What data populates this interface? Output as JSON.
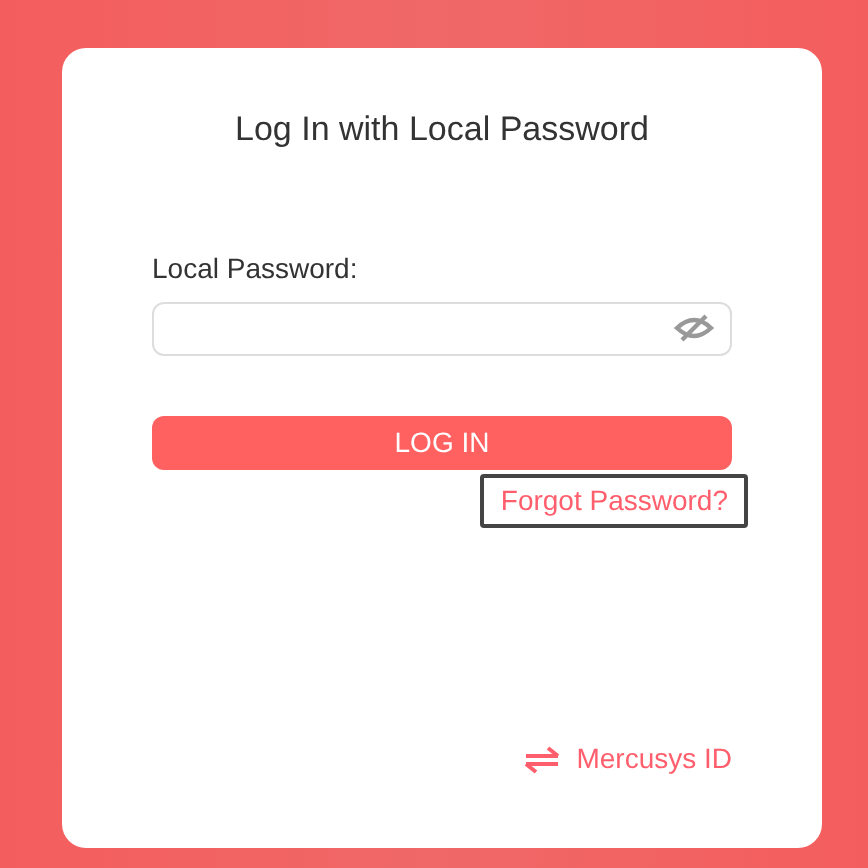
{
  "title": "Log In with Local Password",
  "password": {
    "label": "Local Password:",
    "masked": true
  },
  "login_button": {
    "label": "LOG IN"
  },
  "forgot_link": {
    "label": "Forgot Password?",
    "focused": true
  },
  "switch_link": {
    "label": "Mercusys ID"
  }
}
